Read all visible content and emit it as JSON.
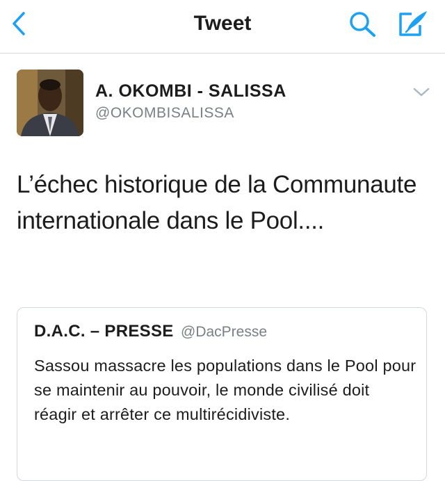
{
  "nav": {
    "title": "Tweet",
    "back_icon": "chevron-left-icon",
    "search_icon": "search-icon",
    "compose_icon": "compose-icon",
    "accent_color": "#1da1f2"
  },
  "tweet": {
    "author_name": "A. OKOMBI - SALISSA",
    "author_handle": "@OKOMBISALISSA",
    "text": "L’échec historique de la Communaute internationale dans le Pool....",
    "menu_icon": "chevron-down-icon"
  },
  "quoted_tweet": {
    "author_name": "D.A.C. – PRESSE",
    "author_handle": "@DacPresse",
    "text": "Sassou massacre les populations  dans le Pool pour se  maintenir au pouvoir, le monde civilisé doit réagir et arrêter ce multirécidiviste."
  }
}
